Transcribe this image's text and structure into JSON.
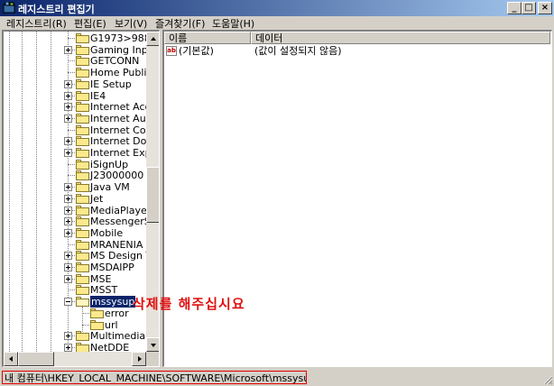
{
  "window": {
    "title": "레지스트리 편집기",
    "minimize_glyph": "_",
    "maximize_glyph": "□",
    "close_glyph": "×"
  },
  "menu": [
    "레지스트리(R)",
    "편집(E)",
    "보기(V)",
    "즐겨찾기(F)",
    "도움말(H)"
  ],
  "tree": {
    "items": [
      {
        "label": "G1973>988",
        "expander": "none"
      },
      {
        "label": "Gaming Input",
        "expander": "plus"
      },
      {
        "label": "GETCONN",
        "expander": "none"
      },
      {
        "label": "Home Publish",
        "expander": "none"
      },
      {
        "label": "IE Setup",
        "expander": "plus"
      },
      {
        "label": "IE4",
        "expander": "plus"
      },
      {
        "label": "Internet Accou",
        "expander": "plus"
      },
      {
        "label": "Internet Audio",
        "expander": "plus"
      },
      {
        "label": "Internet Conne",
        "expander": "none"
      },
      {
        "label": "Internet Domai",
        "expander": "plus"
      },
      {
        "label": "Internet Explor",
        "expander": "plus"
      },
      {
        "label": "iSignUp",
        "expander": "none"
      },
      {
        "label": "J23000000",
        "expander": "none"
      },
      {
        "label": "Java VM",
        "expander": "plus"
      },
      {
        "label": "Jet",
        "expander": "plus"
      },
      {
        "label": "MediaPlayer",
        "expander": "plus"
      },
      {
        "label": "MessengerSe",
        "expander": "plus"
      },
      {
        "label": "Mobile",
        "expander": "plus"
      },
      {
        "label": "MRANENIA",
        "expander": "none"
      },
      {
        "label": "MS Design To",
        "expander": "plus"
      },
      {
        "label": "MSDAIPP",
        "expander": "plus"
      },
      {
        "label": "MSE",
        "expander": "plus"
      },
      {
        "label": "MSST",
        "expander": "none"
      },
      {
        "label": "mssysup",
        "expander": "minus",
        "selected": true
      },
      {
        "label": "error",
        "expander": "none",
        "child": true
      },
      {
        "label": "url",
        "expander": "none",
        "child": true
      },
      {
        "label": "Multimedia",
        "expander": "plus"
      },
      {
        "label": "NetDDE",
        "expander": "plus"
      }
    ]
  },
  "list": {
    "columns": [
      "이름",
      "데이터"
    ],
    "rows": [
      {
        "icon": "ab",
        "name": "(기본값)",
        "data": "(값이 설정되지 않음)"
      }
    ]
  },
  "annotation": "삭제를 해주십시요",
  "status": "내 컴퓨터\\HKEY_LOCAL_MACHINE\\SOFTWARE\\Microsoft\\mssysup",
  "colors": {
    "titlebar_start": "#0a246a",
    "titlebar_end": "#a6caf0",
    "selection": "#0a246a",
    "annotation": "#e01010",
    "folder": "#fce98c"
  },
  "icons": {
    "app": "registry-editor-icon",
    "folder": "folder-icon",
    "value": "string-value-icon"
  }
}
